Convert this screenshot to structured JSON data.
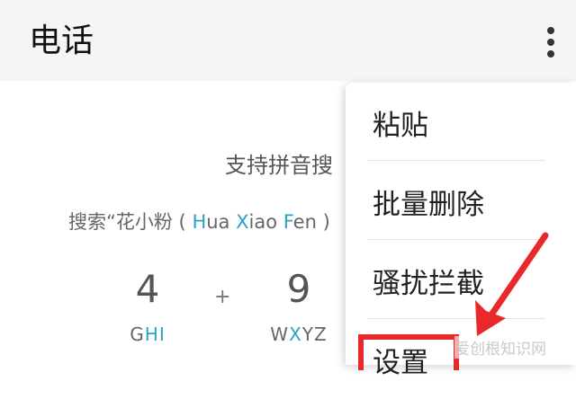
{
  "appbar": {
    "title": "电话",
    "more_icon": "more-vertical-icon"
  },
  "hint": {
    "title": "支持拼音搜",
    "example_prefix": "搜索“花小粉 ( ",
    "example_parts": [
      {
        "text": "H",
        "highlight": true
      },
      {
        "text": "ua ",
        "highlight": false
      },
      {
        "text": "X",
        "highlight": true
      },
      {
        "text": "iao ",
        "highlight": false
      },
      {
        "text": "F",
        "highlight": true
      },
      {
        "text": "en",
        "highlight": false
      }
    ],
    "example_suffix": " )",
    "highlight_color": "#26a3c6"
  },
  "keys": [
    {
      "digit": "4",
      "letters": [
        {
          "text": "G",
          "highlight": false
        },
        {
          "text": "HI",
          "highlight": true
        }
      ]
    },
    {
      "digit": "9",
      "letters": [
        {
          "text": "W",
          "highlight": false
        },
        {
          "text": "X",
          "highlight": true
        },
        {
          "text": "YZ",
          "highlight": false
        }
      ]
    }
  ],
  "plus": "+",
  "menu": {
    "items": [
      "粘贴",
      "批量删除",
      "骚扰拦截",
      "设置"
    ]
  },
  "annotation": {
    "color": "#e8282a"
  },
  "watermark": "爱创根知识网"
}
